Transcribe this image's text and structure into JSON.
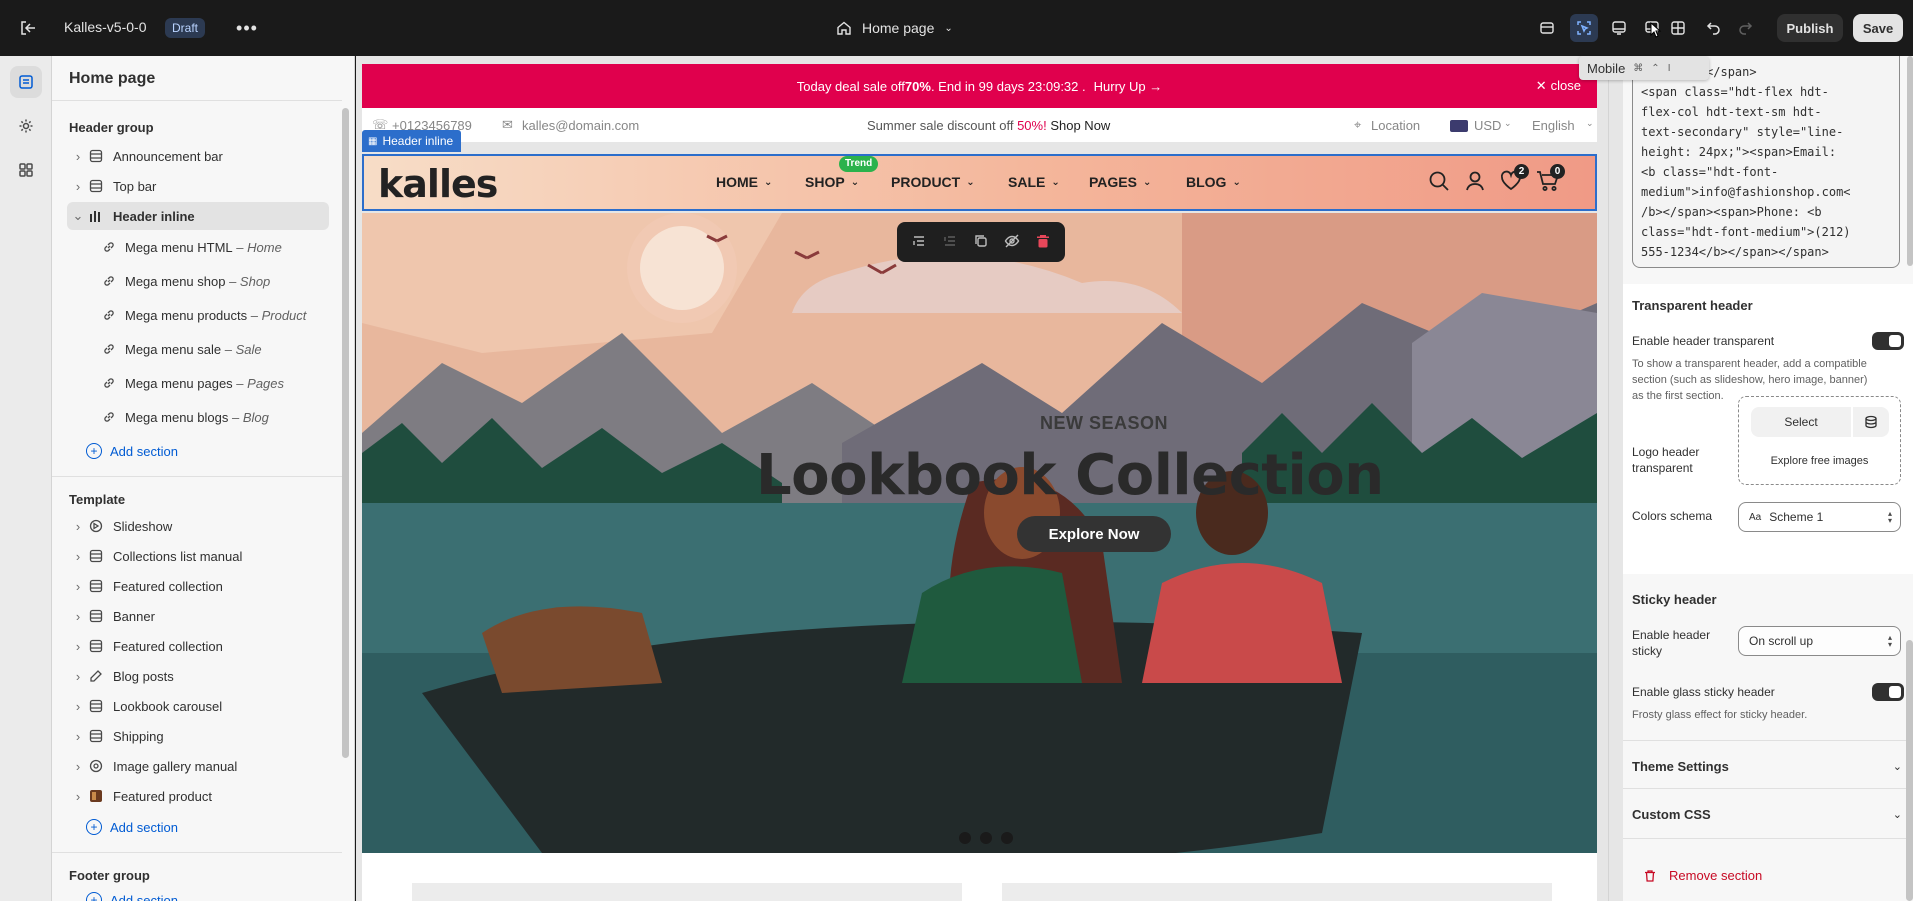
{
  "app": {
    "theme_name": "Kalles-v5-0-0",
    "status_badge": "Draft",
    "page_selector": "Home page",
    "publish_label": "Publish",
    "save_label": "Save"
  },
  "tooltip": {
    "label": "Mobile",
    "keys": [
      "⌘",
      "⌃",
      "I"
    ]
  },
  "sidebar": {
    "title": "Home page",
    "header_group": {
      "title": "Header group",
      "items": [
        {
          "label": "Announcement bar"
        },
        {
          "label": "Top bar"
        },
        {
          "label": "Header inline"
        }
      ],
      "sub_items": [
        {
          "label": "Mega menu HTML",
          "tag": "Home"
        },
        {
          "label": "Mega menu shop",
          "tag": "Shop"
        },
        {
          "label": "Mega menu products",
          "tag": "Product"
        },
        {
          "label": "Mega menu sale",
          "tag": "Sale"
        },
        {
          "label": "Mega menu pages",
          "tag": "Pages"
        },
        {
          "label": "Mega menu blogs",
          "tag": "Blog"
        }
      ],
      "add_section": "Add section"
    },
    "template": {
      "title": "Template",
      "items": [
        {
          "label": "Slideshow"
        },
        {
          "label": "Collections list manual"
        },
        {
          "label": "Featured collection"
        },
        {
          "label": "Banner"
        },
        {
          "label": "Featured collection"
        },
        {
          "label": "Blog posts"
        },
        {
          "label": "Lookbook carousel"
        },
        {
          "label": "Shipping"
        },
        {
          "label": "Image gallery manual"
        },
        {
          "label": "Featured product"
        }
      ],
      "add_section": "Add section"
    },
    "footer_group": {
      "title": "Footer group",
      "add_section": "Add section"
    }
  },
  "preview": {
    "announcement": {
      "prefix": "Today deal sale off ",
      "bold": "70%",
      "suffix": ". End in 99 days 23:09:32 .",
      "link": "Hurry Up →",
      "close": "close"
    },
    "store_topbar": {
      "phone": "+0123456789",
      "email": "kalles@domain.com",
      "promo_prefix": "Summer sale discount off ",
      "promo_pct": "50%!",
      "promo_link": "Shop Now",
      "location": "Location",
      "currency": "USD",
      "language": "English"
    },
    "header_tag": "Header inline",
    "logo": "kalles",
    "nav": [
      {
        "label": "HOME"
      },
      {
        "label": "SHOP",
        "badge": "Trend"
      },
      {
        "label": "PRODUCT"
      },
      {
        "label": "SALE"
      },
      {
        "label": "PAGES"
      },
      {
        "label": "BLOG"
      }
    ],
    "wishlist_count": "2",
    "cart_count": "0",
    "hero": {
      "eyebrow": "NEW SEASON",
      "title": "Lookbook Collection",
      "cta": "Explore Now"
    }
  },
  "settings": {
    "code_lines": [
      "d help ? </span>",
      "<span class=\"hdt-flex hdt-",
      "flex-col hdt-text-sm hdt-",
      "text-secondary\" style=\"line-",
      "height: 24px;\"><span>Email:",
      "<b class=\"hdt-font-",
      "medium\">info@fashionshop.com<",
      "/b></span><span>Phone: <b",
      "class=\"hdt-font-medium\">(212)",
      "555-1234</b></span></span>"
    ],
    "transparent_header": {
      "title": "Transparent header",
      "enable_label": "Enable header transparent",
      "help": [
        "To show a transparent header, add a compatible",
        "section (such as slideshow, hero image, banner)",
        "as the first section."
      ],
      "logo_label": [
        "Logo header",
        "transparent"
      ],
      "select_label": "Select",
      "explore_label": "Explore free images",
      "colors_label": "Colors schema",
      "colors_value": "Scheme 1"
    },
    "sticky_header": {
      "title": "Sticky header",
      "enable_label": [
        "Enable header",
        "sticky"
      ],
      "sticky_value": "On scroll up",
      "glass_label": "Enable glass sticky header",
      "glass_help": "Frosty glass effect for sticky header."
    },
    "theme_settings": "Theme Settings",
    "custom_css": "Custom CSS",
    "remove_section": "Remove section"
  },
  "colors": {
    "accent": "#005bd3",
    "announcement_bg": "#e0004d",
    "selection_blue": "#2c6ecb",
    "danger": "#c70a24",
    "trend_badge": "#2bb24c"
  }
}
